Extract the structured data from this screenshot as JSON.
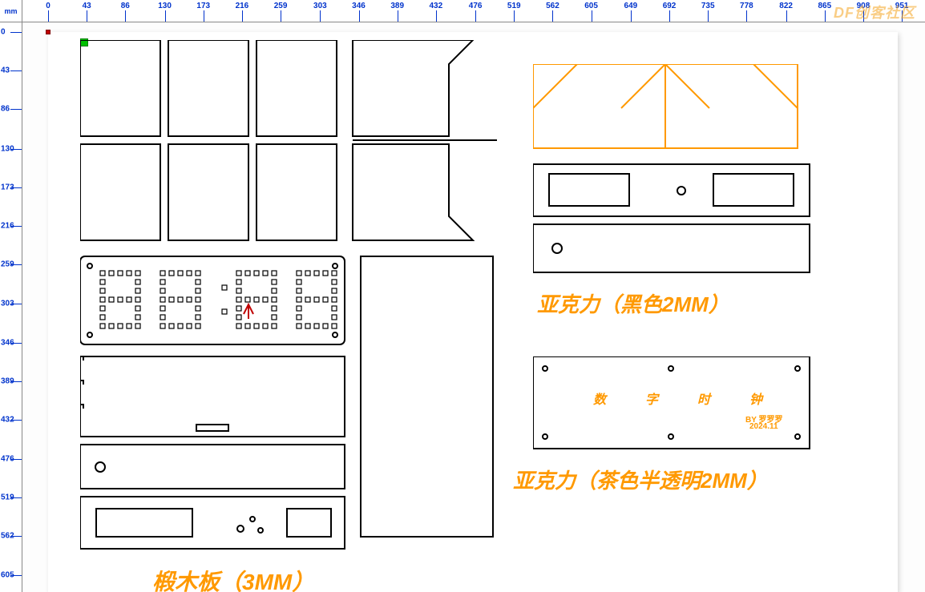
{
  "ruler": {
    "unit": "mm",
    "h_ticks": [
      0,
      43,
      86,
      130,
      173,
      216,
      259,
      303,
      346,
      389,
      432,
      476,
      519,
      562,
      605,
      649,
      692,
      735,
      778,
      822,
      865,
      908,
      951
    ],
    "v_ticks": [
      0,
      43,
      86,
      130,
      173,
      216,
      259,
      303,
      346,
      389,
      432,
      476,
      519,
      562,
      605
    ]
  },
  "watermark": "DF创客社区",
  "annotations": {
    "basswood": "椴木板（3MM）",
    "acrylic_black": "亚克力（黑色2MM）",
    "acrylic_tea": "亚克力（茶色半透明2MM）",
    "clock_title_chars": [
      "数",
      "字",
      "时",
      "钟"
    ],
    "clock_author": "BY 罗罗罗",
    "clock_date": "2024.11"
  },
  "handles": {
    "green": true,
    "red": true
  }
}
